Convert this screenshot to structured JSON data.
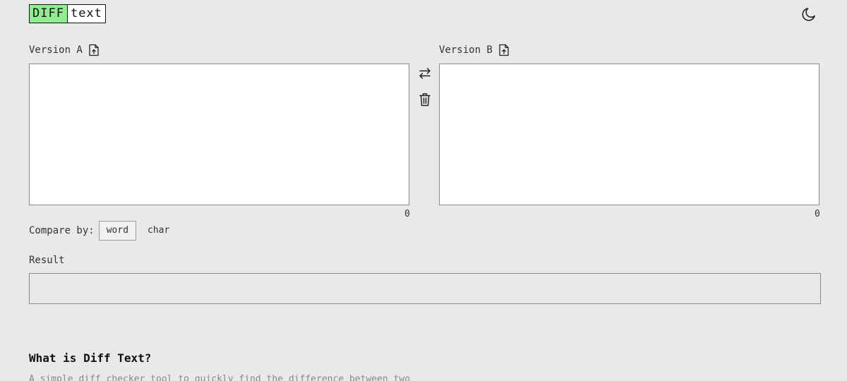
{
  "app": {
    "logo_left": "DIFF",
    "logo_right": "text",
    "theme_icon": "moon-icon"
  },
  "editors": {
    "a": {
      "label": "Version A",
      "value": "",
      "count": "0",
      "upload_icon": "file-upload-icon"
    },
    "b": {
      "label": "Version B",
      "value": "",
      "count": "0",
      "upload_icon": "file-upload-icon"
    }
  },
  "tools": {
    "swap_icon": "swap-arrows-icon",
    "clear_icon": "trash-icon"
  },
  "compare": {
    "label": "Compare by:",
    "options": [
      "word",
      "char"
    ],
    "selected": "word"
  },
  "result": {
    "label": "Result",
    "value": ""
  },
  "about": {
    "title": "What is Diff Text?",
    "description": "A simple diff checker tool to quickly find the difference between two"
  },
  "colors": {
    "background": "#e9e9e9",
    "logo_accent": "#90ee90",
    "border": "#8a8a8a"
  }
}
